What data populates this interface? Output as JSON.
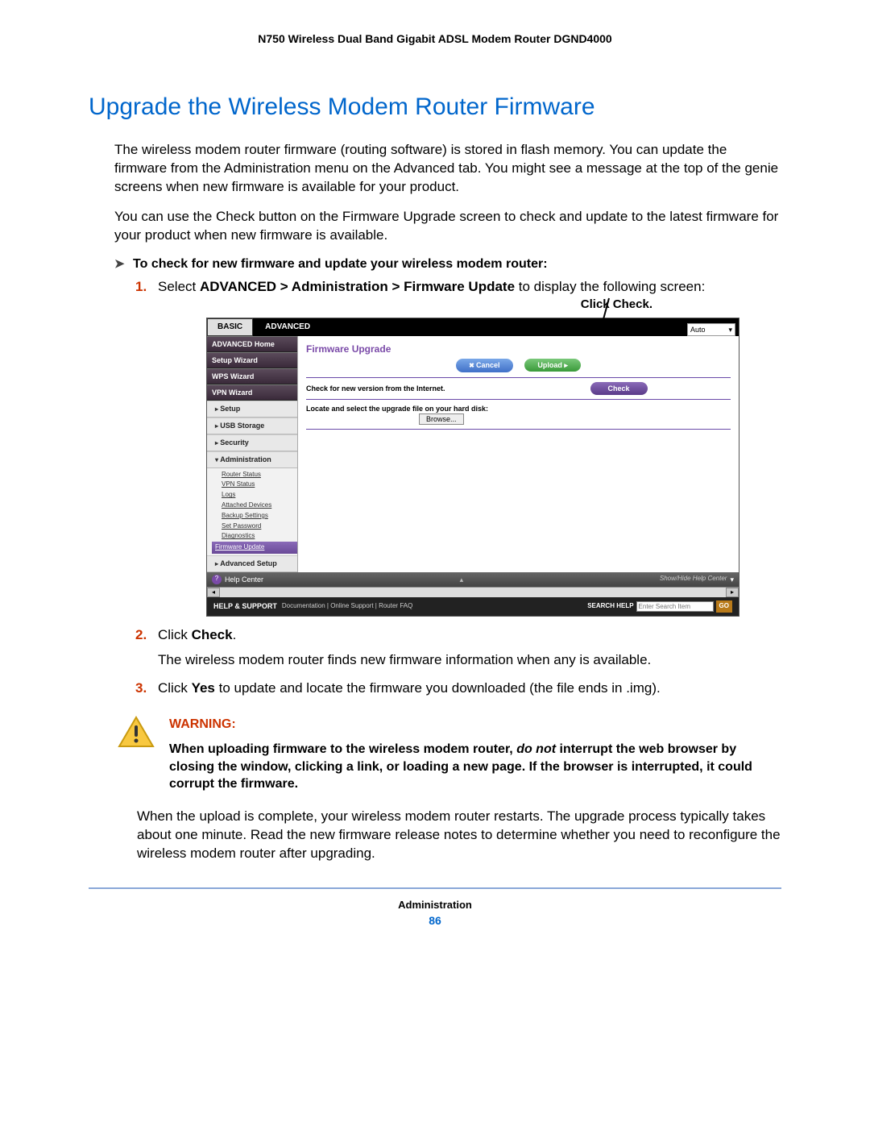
{
  "header": "N750 Wireless Dual Band Gigabit ADSL Modem Router DGND4000",
  "title": "Upgrade the Wireless Modem Router Firmware",
  "para1": "The wireless modem router firmware (routing software) is stored in flash memory. You can update the firmware from the Administration menu on the Advanced tab. You might see a message at the top of the genie screens when new firmware is available for your product.",
  "para2": "You can use the Check button on the Firmware Upgrade screen to check and update to the latest firmware for your product when new firmware is available.",
  "procedure": "To check for new firmware and update your wireless modem router:",
  "steps": {
    "s1_pre": "Select ",
    "s1_bold": "ADVANCED > Administration > Firmware Update",
    "s1_post": " to display the following screen:",
    "s2_pre": "Click ",
    "s2_bold": "Check",
    "s2_post": ".",
    "s2_sub": "The wireless modem router finds new firmware information when any is available.",
    "s3_pre": "Click ",
    "s3_bold": "Yes",
    "s3_post": " to update and locate the firmware you downloaded (the file ends in .img)."
  },
  "callout": "Click Check.",
  "router": {
    "tab_basic": "BASIC",
    "tab_advanced": "ADVANCED",
    "lang": "Auto",
    "side": {
      "home": "ADVANCED Home",
      "setup_wizard": "Setup Wizard",
      "wps_wizard": "WPS Wizard",
      "vpn_wizard": "VPN Wizard",
      "setup": "Setup",
      "usb": "USB Storage",
      "security": "Security",
      "admin": "Administration",
      "submenu": {
        "router_status": "Router Status",
        "vpn_status": "VPN Status",
        "logs": "Logs",
        "attached": "Attached Devices",
        "backup": "Backup Settings",
        "setpw": "Set Password",
        "diag": "Diagnostics",
        "fw": "Firmware Update"
      },
      "advsetup": "Advanced Setup"
    },
    "main": {
      "title": "Firmware Upgrade",
      "cancel": "Cancel",
      "upload": "Upload",
      "row1": "Check for new version from the Internet.",
      "check": "Check",
      "row2": "Locate and select the upgrade file on your hard disk:",
      "browse": "Browse..."
    },
    "help": {
      "label": "Help Center",
      "showhide": "Show/Hide Help Center"
    },
    "footer": {
      "hs": "HELP & SUPPORT",
      "links": "Documentation | Online Support | Router FAQ",
      "search_label": "SEARCH HELP",
      "search_placeholder": "Enter Search Item",
      "go": "GO"
    }
  },
  "warning": {
    "label": "WARNING:",
    "body_pre": "When uploading firmware to the wireless modem router, ",
    "body_ital": "do not",
    "body_post": " interrupt the web browser by closing the window, clicking a link, or loading a new page. If the browser is interrupted, it could corrupt the firmware."
  },
  "para3": "When the upload is complete, your wireless modem router restarts. The upgrade process typically takes about one minute. Read the new firmware release notes to determine whether you need to reconfigure the wireless modem router after upgrading.",
  "foot_section": "Administration",
  "foot_page": "86"
}
